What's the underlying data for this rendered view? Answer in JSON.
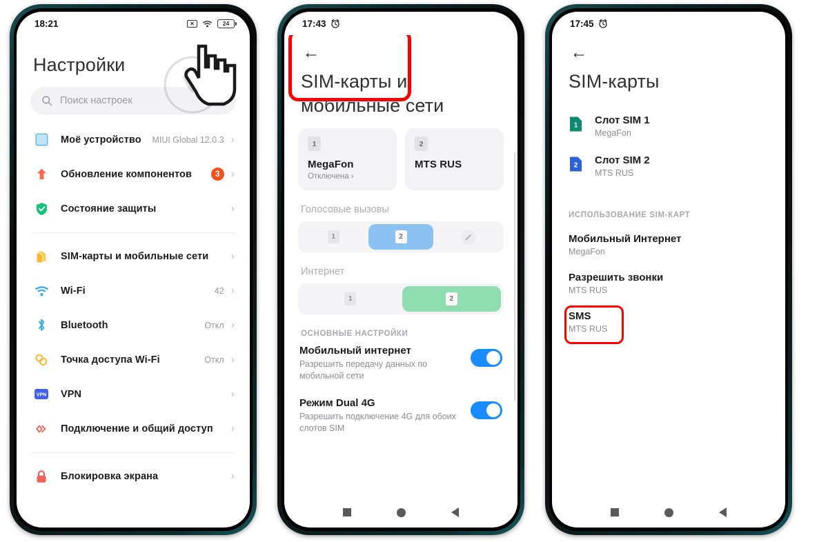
{
  "phone1": {
    "status": {
      "time": "18:21",
      "icons": [
        "no-sim-icon",
        "wifi-icon",
        "battery-icon"
      ],
      "battery_level": "24"
    },
    "title": "Настройки",
    "search": {
      "placeholder": "Поиск настроек",
      "icon": "search-icon"
    },
    "group1": [
      {
        "icon": "device-icon",
        "label": "Моё устройство",
        "value": "MIUI Global 12.0.3",
        "chevron": "›"
      },
      {
        "icon": "update-arrow-icon",
        "label": "Обновление компонентов",
        "badge": "3",
        "chevron": "›"
      },
      {
        "icon": "shield-check-icon",
        "label": "Состояние защиты",
        "value": "",
        "chevron": "›"
      }
    ],
    "group2": [
      {
        "icon": "sim-cards-icon",
        "label": "SIM-карты и мобильные сети",
        "value": "",
        "chevron": "›"
      },
      {
        "icon": "wifi-icon",
        "label": "Wi-Fi",
        "value": "42",
        "chevron": "›"
      },
      {
        "icon": "bluetooth-icon",
        "label": "Bluetooth",
        "value": "Откл",
        "chevron": "›"
      },
      {
        "icon": "hotspot-icon",
        "label": "Точка доступа Wi-Fi",
        "value": "Откл",
        "chevron": "›"
      },
      {
        "icon": "vpn-icon",
        "label": "VPN",
        "value": "",
        "chevron": "›"
      },
      {
        "icon": "share-connection-icon",
        "label": "Подключение и общий доступ",
        "value": "",
        "chevron": "›"
      }
    ],
    "group3": [
      {
        "icon": "lock-icon",
        "label": "Блокировка экрана",
        "value": "",
        "chevron": "›"
      }
    ],
    "cursor": "hand-pointer-cursor"
  },
  "phone2": {
    "status": {
      "time": "17:43",
      "icons": [
        "alarm-icon"
      ]
    },
    "back": "←",
    "title": "SIM-карты и мобильные сети",
    "sim_tiles": [
      {
        "num": "1",
        "name": "MegaFon",
        "sub": "Отключена ›",
        "highlighted": true
      },
      {
        "num": "2",
        "name": "MTS RUS",
        "sub": "",
        "highlighted": false
      }
    ],
    "voice_section": {
      "label": "Голосовые вызовы",
      "options": [
        "1",
        "2"
      ],
      "selected": "2",
      "edit_icon": "pencil-icon"
    },
    "internet_section": {
      "label": "Интернет",
      "options": [
        "1",
        "2"
      ],
      "selected": "2"
    },
    "main_settings_label": "ОСНОВНЫЕ НАСТРОЙКИ",
    "prefs": [
      {
        "title": "Мобильный интернет",
        "sub": "Разрешить передачу данных по мобильной сети",
        "toggle": "on"
      },
      {
        "title": "Режим Dual 4G",
        "sub": "Разрешить подключение 4G для обоих слотов SIM",
        "toggle": "on"
      }
    ],
    "navbar": [
      "recent-apps-icon",
      "home-icon",
      "back-nav-icon"
    ]
  },
  "phone3": {
    "status": {
      "time": "17:45",
      "icons": [
        "alarm-icon"
      ]
    },
    "back": "←",
    "title": "SIM-карты",
    "slots": [
      {
        "num": "1",
        "title": "Слот SIM 1",
        "sub": "MegaFon",
        "color": "#0d8a6f"
      },
      {
        "num": "2",
        "title": "Слот SIM 2",
        "sub": "MTS RUS",
        "color": "#3060d8"
      }
    ],
    "usage_label": "ИСПОЛЬЗОВАНИЕ SIM-КАРТ",
    "usage": [
      {
        "title": "Мобильный Интернет",
        "sub": "MegaFon",
        "highlighted": false
      },
      {
        "title": "Разрешить звонки",
        "sub": "MTS RUS",
        "highlighted": false
      },
      {
        "title": "SMS",
        "sub": "MTS RUS",
        "highlighted": true
      }
    ],
    "navbar": [
      "recent-apps-icon",
      "home-icon",
      "back-nav-icon"
    ]
  },
  "colors": {
    "accent_blue": "#1a8cff",
    "highlight_red": "#ff0000",
    "badge_orange": "#f4511e",
    "seg_blue": "#8cc2f2",
    "seg_green": "#8fdcb0"
  }
}
